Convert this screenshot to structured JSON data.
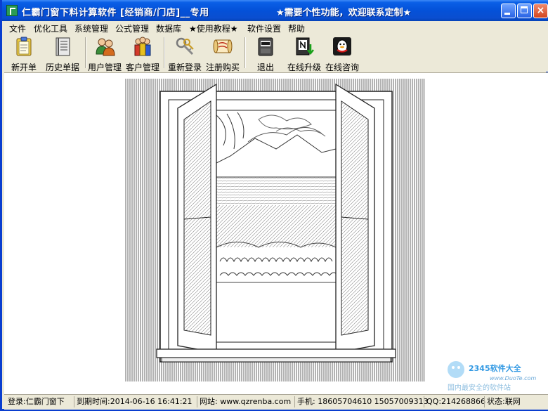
{
  "window": {
    "title": "仁霸门窗下料计算软件 [经销商/门店]__专用",
    "slogan": "★需要个性功能，欢迎联系定制★",
    "buttons": {
      "minimize": "minimize",
      "maximize": "maximize",
      "close": "×"
    }
  },
  "menu": {
    "items": [
      {
        "label": "文件"
      },
      {
        "label": "优化工具"
      },
      {
        "label": "系统管理"
      },
      {
        "label": "公式管理"
      },
      {
        "label": "数据库"
      },
      {
        "label": "★使用教程★"
      },
      {
        "label": "软件设置"
      },
      {
        "label": "帮助"
      }
    ]
  },
  "toolbar": {
    "buttons": [
      {
        "label": "新开单",
        "icon": "clipboard-icon"
      },
      {
        "label": "历史单据",
        "icon": "ledger-icon"
      },
      {
        "label": "用户管理",
        "icon": "users-icon"
      },
      {
        "label": "客户管理",
        "icon": "customers-icon"
      },
      {
        "label": "重新登录",
        "icon": "keys-icon"
      },
      {
        "label": "注册购买",
        "icon": "scroll-icon"
      },
      {
        "label": "退出",
        "icon": "exit-icon"
      },
      {
        "label": "在线升级",
        "icon": "upgrade-icon"
      },
      {
        "label": "在线咨询",
        "icon": "qq-icon"
      }
    ]
  },
  "status": {
    "login": "登录:仁霸门窗下",
    "expiry": "到期时间:2014-06-16 16:41:21",
    "website": "网站: www.qzrenba.com",
    "phone": "手机: 18605704610 15057009313",
    "qq": "QQ:214268866",
    "state": "状态:联网"
  },
  "watermark": {
    "brand": "2345软件大全",
    "site": "www.DuoTe.com",
    "tagline": "国内最安全的软件站"
  },
  "colors": {
    "titlebar": "#0451d8",
    "frame": "#ece9d8",
    "close": "#d2451f"
  }
}
